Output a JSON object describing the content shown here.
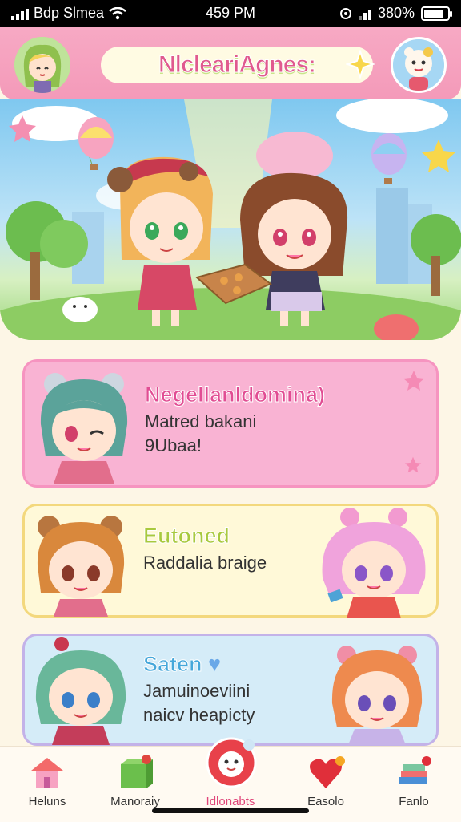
{
  "status": {
    "carrier": "Bdp Slmea",
    "time": "459 PM",
    "battery": "380%",
    "battery_level": 0.85
  },
  "app": {
    "title": "NlcleariАgnes:"
  },
  "cards": [
    {
      "title": "Negellanldomina)",
      "text1": "Matred bakani",
      "text2": "9Ubaa!"
    },
    {
      "title": "Eutoned",
      "text1": "Raddalia braige"
    },
    {
      "title": "Saten",
      "text1": "Jamuinoeviini",
      "text2": "naicv heapicty"
    }
  ],
  "tabs": [
    {
      "label": "Heluns",
      "icon": "house-icon"
    },
    {
      "label": "Manoraiy",
      "icon": "gift-box-icon"
    },
    {
      "label": "Idlonabts",
      "icon": "mascot-face-icon",
      "active": true
    },
    {
      "label": "Easolo",
      "icon": "heart-icon"
    },
    {
      "label": "Fanlo",
      "icon": "book-stack-icon"
    }
  ],
  "colors": {
    "header": "#f49ab9",
    "accent": "#e0467a",
    "card1": "#f9b3d3",
    "card2": "#fff9d8",
    "card3": "#d5ecf8"
  }
}
